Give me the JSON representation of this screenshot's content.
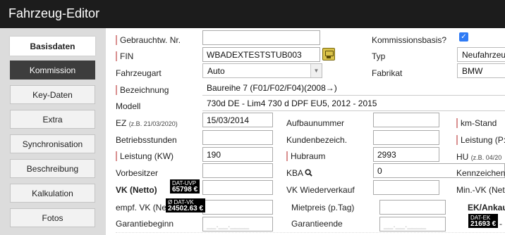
{
  "app": {
    "title": "Fahrzeug-Editor"
  },
  "sidebar": {
    "items": [
      {
        "label": "Basisdaten"
      },
      {
        "label": "Kommission"
      },
      {
        "label": "Key-Daten"
      },
      {
        "label": "Extra"
      },
      {
        "label": "Synchronisation"
      },
      {
        "label": "Beschreibung"
      },
      {
        "label": "Kalkulation"
      },
      {
        "label": "Fotos"
      }
    ]
  },
  "form": {
    "gebrauchtw_nr": {
      "label": "Gebrauchtw. Nr.",
      "value": ""
    },
    "kommissionsbasis": {
      "label": "Kommissionsbasis?",
      "checked": true
    },
    "fin": {
      "label": "FIN",
      "value": "WBADEXTESTSTUB003"
    },
    "typ": {
      "label": "Typ",
      "value": "Neufahrzeu"
    },
    "fahrzeugart": {
      "label": "Fahrzeugart",
      "value": "Auto"
    },
    "fabrikat": {
      "label": "Fabrikat",
      "value": "BMW"
    },
    "bezeichnung": {
      "label": "Bezeichnung",
      "value": "Baureihe 7 (F01/F02/F04)(2008→)"
    },
    "modell": {
      "label": "Modell",
      "value": "730d DE - Lim4 730 d DPF EU5, 2012 - 2015"
    },
    "ez": {
      "label": "EZ",
      "hint": "(z.B. 21/03/2020)",
      "value": "15/03/2014"
    },
    "aufbaunummer": {
      "label": "Aufbaunummer",
      "value": ""
    },
    "km_stand": {
      "label": "km-Stand"
    },
    "betriebsstunden": {
      "label": "Betriebsstunden",
      "value": ""
    },
    "kundenbezeich": {
      "label": "Kundenbezeich.",
      "value": ""
    },
    "leistung_ps": {
      "label": "Leistung (P:"
    },
    "leistung_kw": {
      "label": "Leistung (KW)",
      "value": "190"
    },
    "hubraum": {
      "label": "Hubraum",
      "value": "2993"
    },
    "hu": {
      "label": "HU",
      "hint": "(z.B. 04/20"
    },
    "vorbesitzer": {
      "label": "Vorbesitzer",
      "value": ""
    },
    "kba": {
      "label": "KBA",
      "value": "0"
    },
    "kennzeichen": {
      "label": "Kennzeichen"
    },
    "vk_netto": {
      "label": "VK (Netto)",
      "value": ""
    },
    "dat_uvp": {
      "line1": "DAT-UVP",
      "line2": "65798 €"
    },
    "vk_wiederverkauf": {
      "label": "VK Wiederverkauf",
      "value": ""
    },
    "min_vk": {
      "label": "Min.-VK (Net"
    },
    "empf_vk": {
      "label": "empf. VK (Net",
      "value": ""
    },
    "dat_vk": {
      "line1": "Ø DAT-VK",
      "line2": "24502.63 €"
    },
    "mietpreis": {
      "label": "Mietpreis (p.Tag)",
      "value": ""
    },
    "ek_ankauf": {
      "label": "EK/Ankau"
    },
    "dat_ek": {
      "line1": "DAT-EK",
      "line2": "21693 €"
    },
    "ek_suffix": "-",
    "garantiebeginn": {
      "label": "Garantiebeginn",
      "placeholder": "__.__.____"
    },
    "garantieende": {
      "label": "Garantieende",
      "placeholder": "__.__.____"
    }
  }
}
